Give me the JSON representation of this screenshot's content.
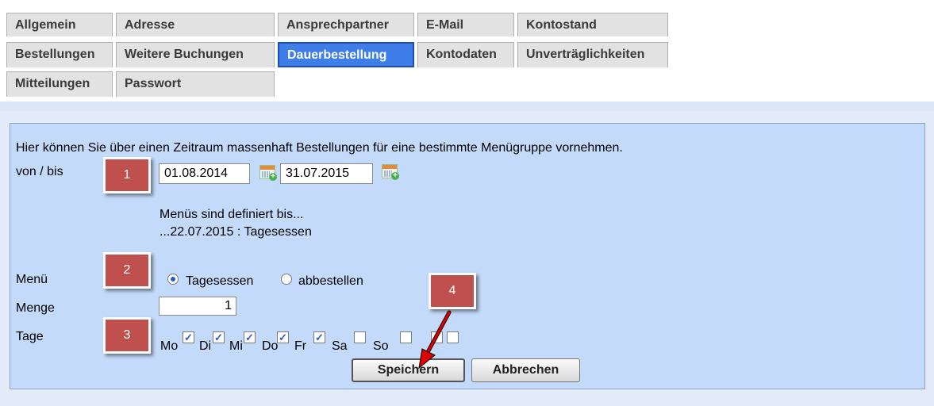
{
  "tabs": [
    {
      "label": "Allgemein",
      "active": false
    },
    {
      "label": "Adresse",
      "active": false
    },
    {
      "label": "Ansprechpartner",
      "active": false
    },
    {
      "label": "E-Mail",
      "active": false
    },
    {
      "label": "Kontostand",
      "active": false
    },
    {
      "label": "Bestellungen",
      "active": false
    },
    {
      "label": "Weitere Buchungen",
      "active": false
    },
    {
      "label": "Dauerbestellung",
      "active": true
    },
    {
      "label": "Kontodaten",
      "active": false
    },
    {
      "label": "Unverträglichkeiten",
      "active": false
    },
    {
      "label": "Mitteilungen",
      "active": false
    },
    {
      "label": "Passwort",
      "active": false
    }
  ],
  "form": {
    "intro": "Hier können Sie über einen Zeitraum massenhaft Bestellungen für eine bestimmte Menügruppe vornehmen.",
    "period_label": "von / bis",
    "date_from": "01.08.2014",
    "date_to": "31.07.2015",
    "menus_defined_line1": "Menüs sind definiert bis...",
    "menus_defined_line2": "...22.07.2015 : Tagesessen",
    "menu_label": "Menü",
    "menu_options": [
      {
        "label": "Tagesessen",
        "selected": true
      },
      {
        "label": "abbestellen",
        "selected": false
      }
    ],
    "quantity_label": "Menge",
    "quantity": "1",
    "days_label": "Tage",
    "days": [
      {
        "label": "Mo",
        "checked": true
      },
      {
        "label": "Di",
        "checked": true
      },
      {
        "label": "Mi",
        "checked": true
      },
      {
        "label": "Do",
        "checked": true
      },
      {
        "label": "Fr",
        "checked": false
      },
      {
        "label": "Sa",
        "checked": false
      },
      {
        "label": "So",
        "checked": false
      }
    ],
    "save_label": "Speichern",
    "cancel_label": "Abbrechen"
  },
  "markers": [
    "1",
    "2",
    "3",
    "4"
  ],
  "colors": {
    "active_tab": "#3f7de8",
    "panel_bg": "#c4dafa",
    "marker": "#c0504d",
    "arrow": "#e00000"
  },
  "icons": {
    "calendar": "calendar-add-icon",
    "annotation_arrow": "red-arrow-icon"
  }
}
